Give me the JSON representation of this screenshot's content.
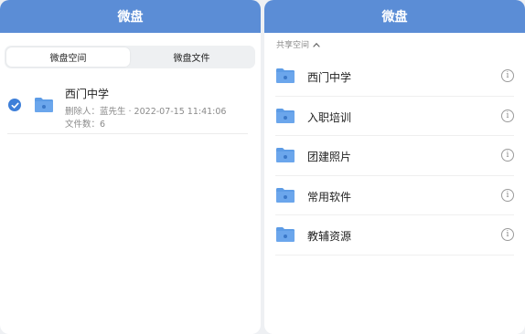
{
  "left": {
    "title": "微盘",
    "tabs": [
      {
        "label": "微盘空间",
        "active": true
      },
      {
        "label": "微盘文件",
        "active": false
      }
    ],
    "item": {
      "name": "西门中学",
      "meta_line1": "删除人：蓝先生 · 2022-07-15 11:41:06",
      "meta_line2": "文件数：6",
      "checked": true
    }
  },
  "right": {
    "title": "微盘",
    "section_label": "共享空间",
    "folders": [
      {
        "name": "西门中学"
      },
      {
        "name": "入职培训"
      },
      {
        "name": "团建照片"
      },
      {
        "name": "常用软件"
      },
      {
        "name": "教辅资源"
      }
    ],
    "info_glyph": "i"
  },
  "colors": {
    "header": "#5b8dd6",
    "accent": "#3e7fd9",
    "folder": "#5d9ce6"
  },
  "icons": {
    "check": "checkmark-icon",
    "folder": "folder-icon",
    "info": "info-icon",
    "chevron": "chevron-up-icon"
  }
}
